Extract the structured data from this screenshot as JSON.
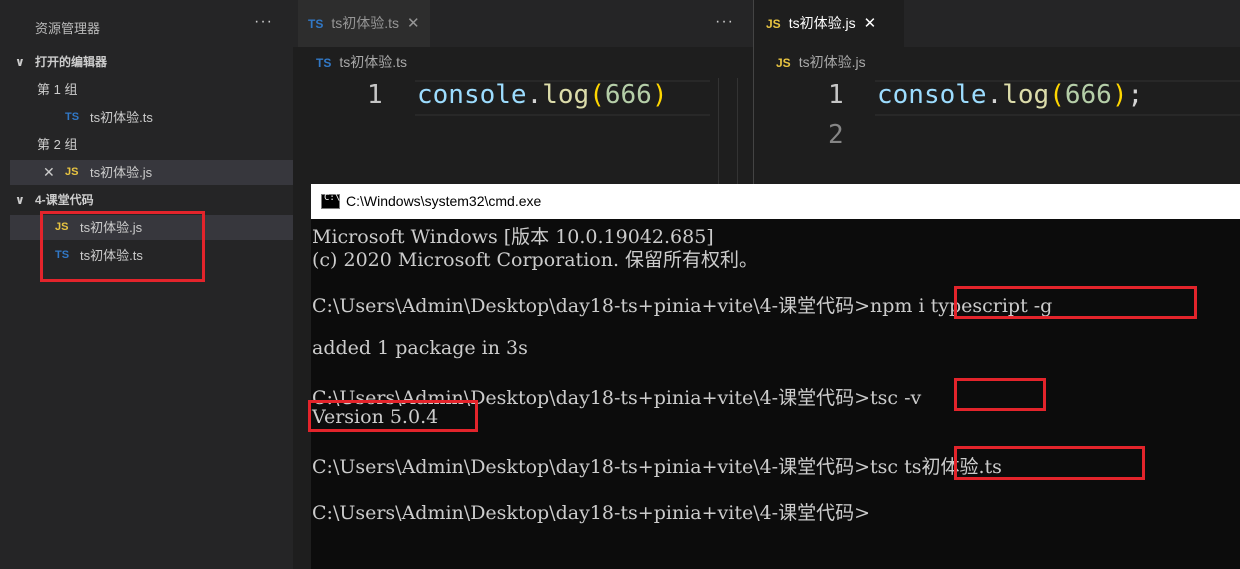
{
  "sidebar": {
    "title": "资源管理器",
    "more": "···",
    "open_editors": "打开的编辑器",
    "group1": "第 1 组",
    "group1_file": "ts初体验.ts",
    "group2": "第 2 组",
    "group2_file": "ts初体验.js",
    "folder": "4-课堂代码",
    "files": [
      "ts初体验.js",
      "ts初体验.ts"
    ]
  },
  "icons": {
    "ts": "TS",
    "js": "JS",
    "chevron": "chevron-down-icon",
    "close": "close-icon"
  },
  "editor_left": {
    "tab": "ts初体验.ts",
    "breadcrumb": "ts初体验.ts",
    "more": "···",
    "line_numbers": [
      "1"
    ],
    "code": {
      "obj": "console",
      "dot": ".",
      "fn": "log",
      "open": "(",
      "num": "666",
      "close": ")"
    }
  },
  "editor_right": {
    "tab": "ts初体验.js",
    "breadcrumb": "ts初体验.js",
    "line_numbers": [
      "1",
      "2"
    ],
    "code": {
      "obj": "console",
      "dot": ".",
      "fn": "log",
      "open": "(",
      "num": "666",
      "close": ")",
      "semi": ";"
    }
  },
  "cmd": {
    "title": "C:\\Windows\\system32\\cmd.exe",
    "icon_label": "C:\\",
    "lines": [
      "Microsoft Windows [版本 10.0.19042.685]",
      "(c) 2020 Microsoft Corporation. 保留所有权利。",
      "C:\\Users\\Admin\\Desktop\\day18-ts+pinia+vite\\4-课堂代码>npm i typescript -g",
      "added 1 package in 3s",
      "C:\\Users\\Admin\\Desktop\\day18-ts+pinia+vite\\4-课堂代码>tsc -v",
      "Version 5.0.4",
      "C:\\Users\\Admin\\Desktop\\day18-ts+pinia+vite\\4-课堂代码>tsc ts初体验.ts",
      "C:\\Users\\Admin\\Desktop\\day18-ts+pinia+vite\\4-课堂代码>"
    ]
  },
  "colors": {
    "highlight": "#e3242b",
    "ts_blue": "#3178c6",
    "js_yellow": "#e8c441"
  }
}
